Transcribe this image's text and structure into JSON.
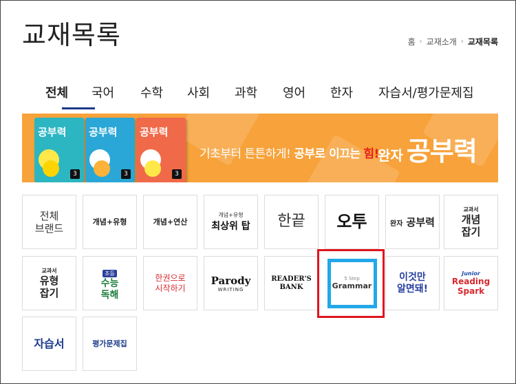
{
  "page": {
    "title": "교재목록"
  },
  "breadcrumb": {
    "items": [
      "홈",
      "교재소개",
      "교재목록"
    ]
  },
  "tabs": [
    {
      "label": "전체",
      "active": true
    },
    {
      "label": "국어"
    },
    {
      "label": "수학"
    },
    {
      "label": "사회"
    },
    {
      "label": "과학"
    },
    {
      "label": "영어"
    },
    {
      "label": "한자"
    },
    {
      "label": "자습서/평가문제집"
    }
  ],
  "banner": {
    "books": [
      {
        "title": "공부력",
        "grade": "3"
      },
      {
        "title": "공부력",
        "grade": "3"
      },
      {
        "title": "공부력",
        "grade": "3"
      }
    ],
    "slogan_part1": "기초부터 튼튼하게!",
    "slogan_part2": "공부로 이끄는",
    "slogan_part3": "힘!",
    "brand_prefix": "완자",
    "brand_name": "공부력",
    "color_bg": "#f7a23a"
  },
  "brands": [
    {
      "label": "전체\n브랜드"
    },
    {
      "label": "개념+유형"
    },
    {
      "label": "개념+연산"
    },
    {
      "label_small": "개념+유형",
      "label": "최상위 탑"
    },
    {
      "label": "한끝"
    },
    {
      "label": "오투"
    },
    {
      "label_small": "완자",
      "label": "공부력"
    },
    {
      "label_small": "교과서",
      "label": "개념\n잡기"
    },
    {
      "label_small": "교과서",
      "label": "유형\n잡기"
    },
    {
      "label_small": "초등",
      "label": "수능\n독해"
    },
    {
      "label": "한권으로\n시작하기"
    },
    {
      "label": "Parody",
      "label_small": "WRITING"
    },
    {
      "label": "READER'S\nBANK"
    },
    {
      "label_small": "5 Step",
      "label": "Grammar",
      "selected": true
    },
    {
      "label": "이것만\n알면돼!"
    },
    {
      "label_small": "Junior",
      "label": "Reading\nSpark"
    },
    {
      "label": "자습서"
    },
    {
      "label": "평가문제집"
    }
  ],
  "colors": {
    "accent_navy": "#1b3a8c",
    "selection_red": "#e0141e",
    "grammar_blue": "#22a8e8"
  }
}
